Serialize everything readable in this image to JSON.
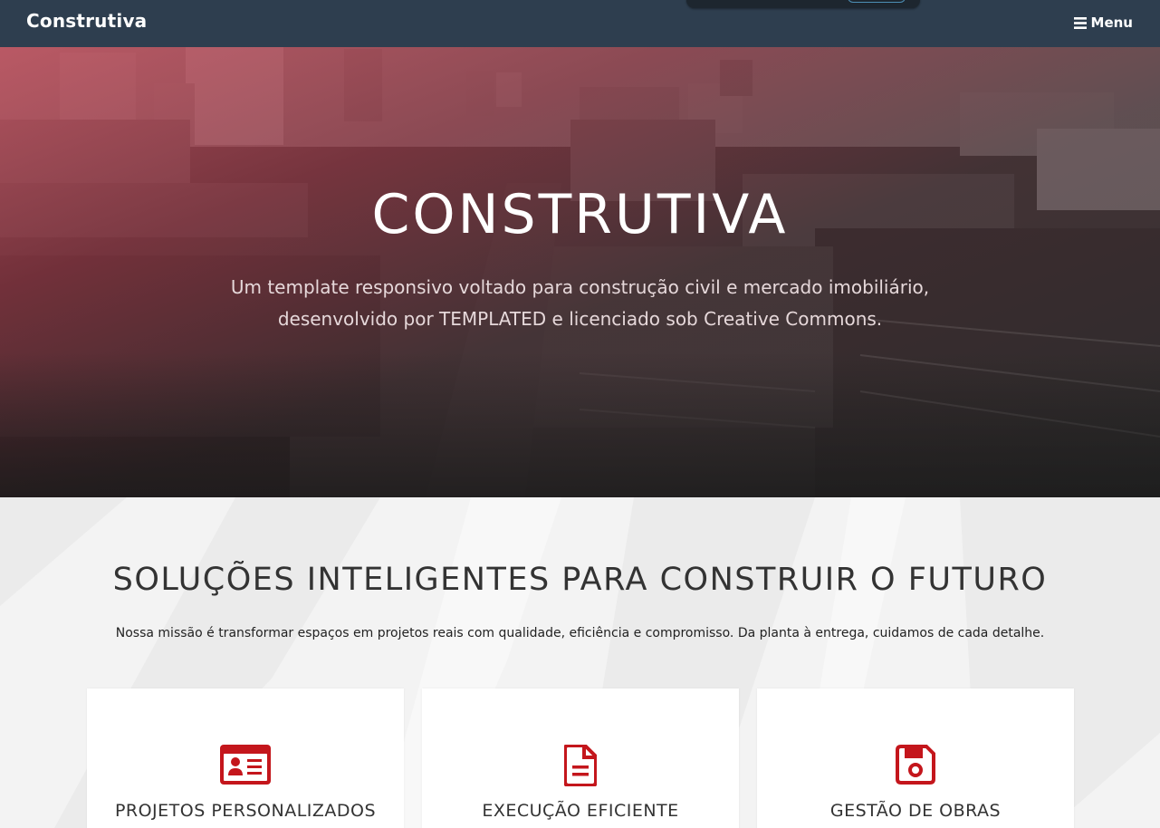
{
  "nav": {
    "brand": "Construtiva",
    "menu_label": "Menu"
  },
  "hero": {
    "title": "CONSTRUTIVA",
    "subtitle_line1": "Um template responsivo voltado para construção civil e mercado imobiliário,",
    "subtitle_line2": "desenvolvido por TEMPLATED e licenciado sob Creative Commons."
  },
  "section": {
    "title": "SOLUÇÕES INTELIGENTES PARA CONSTRUIR O FUTURO",
    "text": "Nossa missão é transformar espaços em projetos reais com qualidade, eficiência e compromisso. Da planta à entrega, cuidamos de cada detalhe."
  },
  "cards": [
    {
      "icon": "id-card-icon",
      "title": "PROJETOS PERSONALIZADOS"
    },
    {
      "icon": "document-icon",
      "title": "EXECUÇÃO EFICIENTE"
    },
    {
      "icon": "floppy-disk-icon",
      "title": "GESTÃO DE OBRAS"
    }
  ],
  "colors": {
    "nav_bg": "#2e3e4f",
    "accent": "#c4161c",
    "hero_tint": "#c44e5c"
  }
}
